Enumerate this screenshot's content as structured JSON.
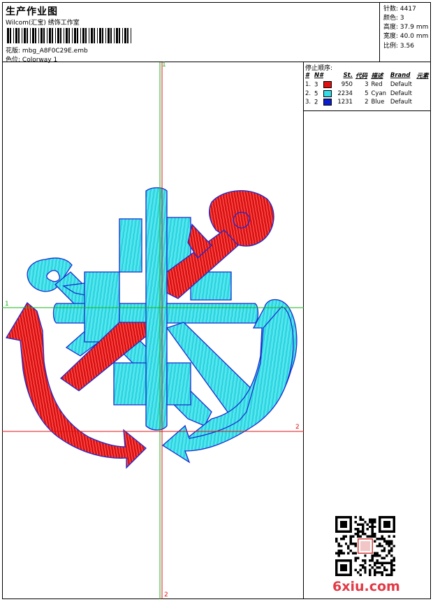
{
  "header": {
    "title": "生产作业图",
    "company": "Wilcom(汇宝) 绣饰工作室",
    "design_label": "花版:",
    "design_value": "mbg_A8F0C29E.emb",
    "colorway_label": "色位:",
    "colorway_value": "Colorway 1"
  },
  "stats": [
    {
      "label": "针数:",
      "value": "4417"
    },
    {
      "label": "颜色:",
      "value": "3"
    },
    {
      "label": "高度:",
      "value": "37.9 mm"
    },
    {
      "label": "宽度:",
      "value": "40.0 mm"
    },
    {
      "label": "比例:",
      "value": "3.56"
    }
  ],
  "stop_sequence": {
    "title": "停止顺序:",
    "headers": [
      "#",
      "N#",
      "St.",
      "代码",
      "描述",
      "Brand",
      "元素"
    ],
    "rows": [
      {
        "idx": "1.",
        "n": "3",
        "color": "#e01010",
        "st": "950",
        "code": "3",
        "desc": "Red",
        "brand": "Default"
      },
      {
        "idx": "2.",
        "n": "5",
        "color": "#33dde8",
        "st": "2234",
        "code": "5",
        "desc": "Cyan",
        "brand": "Default"
      },
      {
        "idx": "3.",
        "n": "2",
        "color": "#0a1ecf",
        "st": "1231",
        "code": "2",
        "desc": "Blue",
        "brand": "Default"
      }
    ]
  },
  "axis_labels": {
    "top": "1",
    "left": "1",
    "right": "2",
    "bottom": "2"
  },
  "colors": {
    "red": "#e01010",
    "cyan": "#33dde8",
    "blue_outline": "#1a2bd0",
    "green_axis": "#19b319",
    "red_axis": "#e01010"
  },
  "watermark": "6xiu.com",
  "icons": {
    "qr": "qr-code-icon",
    "barcode": "barcode-icon"
  }
}
